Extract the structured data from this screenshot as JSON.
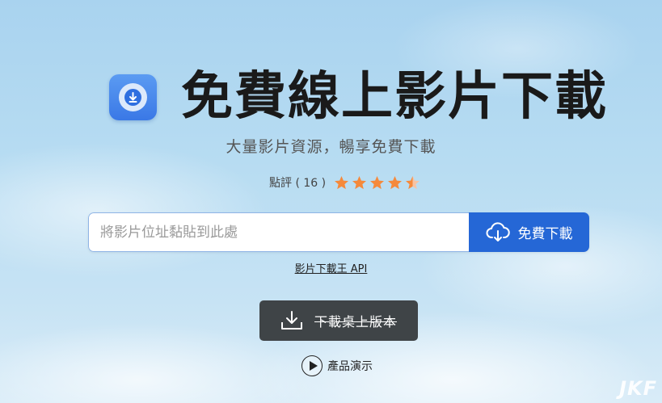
{
  "header": {
    "title": "免費線上影片下載",
    "subtitle": "大量影片資源，暢享免費下載"
  },
  "rating": {
    "label": "點評 ( 16 )",
    "value": 4.5,
    "max": 5,
    "star_color": "#f5893b"
  },
  "url_form": {
    "placeholder": "將影片位址黏貼到此處",
    "value": "",
    "button_label": "免費下載",
    "button_color": "#2567d6"
  },
  "api_link": {
    "label": "影片下載王 API"
  },
  "desktop_button": {
    "label": "下載桌上版本",
    "color": "#3f4447"
  },
  "demo": {
    "label": "產品演示"
  },
  "icons": {
    "logo": "download-circle-icon",
    "cloud": "cloud-download-icon",
    "desktop": "download-tray-icon",
    "play": "play-icon"
  },
  "watermark": {
    "text": "JKF"
  }
}
